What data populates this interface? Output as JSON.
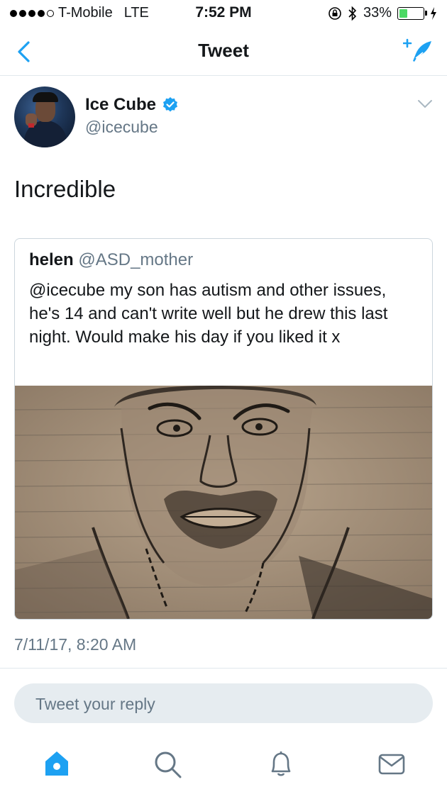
{
  "status_bar": {
    "carrier": "T-Mobile",
    "network": "LTE",
    "time": "7:52 PM",
    "battery": "33%",
    "battery_level": 0.33
  },
  "nav": {
    "title": "Tweet",
    "back_icon": "chevron-left-icon",
    "compose_icon": "compose-tweet-icon"
  },
  "tweet": {
    "author_name": "Ice Cube",
    "author_handle": "@icecube",
    "verified": true,
    "text": "Incredible",
    "timestamp": "7/11/17, 8:20 AM",
    "quoted": {
      "name": "helen",
      "handle": "@ASD_mother",
      "text": "@icecube my son has autism and other issues, he's 14 and can't write well but he drew this last night. Would make his day if you liked it x"
    }
  },
  "reply": {
    "placeholder": "Tweet your reply"
  },
  "tabbar": {
    "items": [
      "home-icon",
      "search-icon",
      "notifications-icon",
      "messages-icon"
    ]
  },
  "colors": {
    "accent": "#1da1f2",
    "secondary_text": "#657786",
    "reply_bg": "#e6ecf0"
  }
}
